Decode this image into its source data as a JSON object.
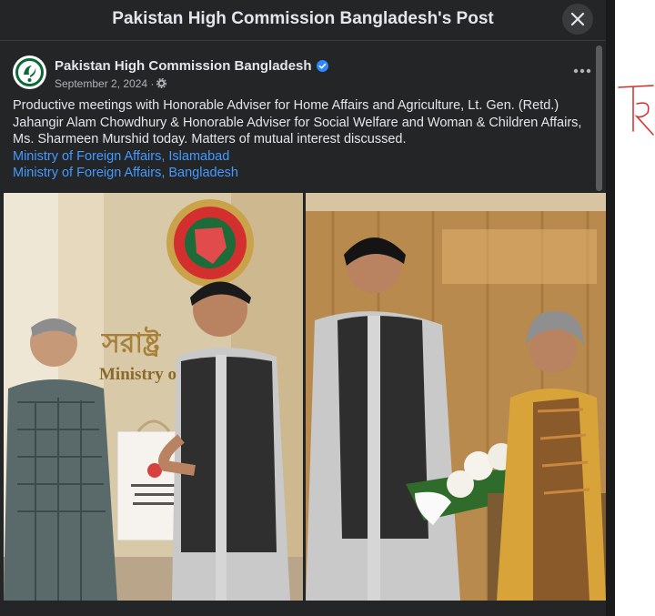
{
  "modal": {
    "title": "Pakistan High Commission Bangladesh's Post",
    "close_icon": "close-icon"
  },
  "post": {
    "page_name": "Pakistan High Commission Bangladesh",
    "date": "September 2, 2024 ·",
    "body": "Productive meetings with Honorable Adviser for Home Affairs and Agriculture, Lt. Gen. (Retd.) Jahangir Alam Chowdhury & Honorable Adviser for Social Welfare and Woman & Children Affairs, Ms. Sharmeen Murshid today. Matters of mutual interest discussed.",
    "links": [
      "Ministry of Foreign Affairs, Islamabad",
      "Ministry of Foreign Affairs, Bangladesh"
    ],
    "photos": [
      {
        "sign_text": "Ministry of"
      },
      {
        "sign_text": ""
      }
    ]
  },
  "colors": {
    "modal_bg": "#242526",
    "text": "#e4e6eb",
    "secondary_text": "#b0b3b8",
    "link": "#4599ff",
    "verified": "#2d88ff",
    "annotation_red": "#d62b2b"
  }
}
